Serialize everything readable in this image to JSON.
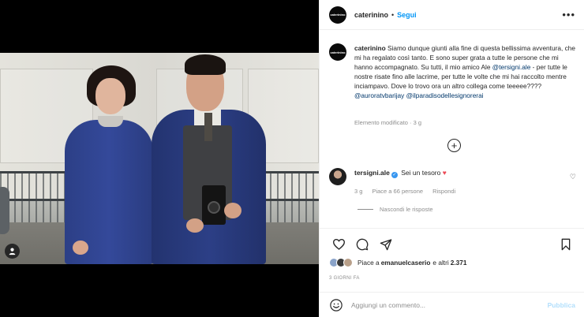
{
  "post": {
    "author": "caterinino",
    "follow_label": "Segui",
    "avatar_text": "caterinino",
    "more_label": "•••"
  },
  "caption": {
    "username": "caterinino",
    "text_1": "Siamo dunque giunti alla fine di questa bellissima avventura, che mi ha regalato così tanto. E sono super grata a tutte le persone che mi hanno accompagnato. Su tutti, il mio amico Ale ",
    "mention_1": "@tersigni.ale",
    "text_2": " - per tutte le nostre risate fino alle lacrime, per tutte le volte che mi hai raccolto mentre inciampavo. Dove lo trovo ora un altro collega come teeeee???? ",
    "mention_2": "@auroratvbarijay",
    "mention_3": "@ilparadisodellesignorerai",
    "meta": "Elemento modificato · 3 g"
  },
  "comments": [
    {
      "username": "tersigni.ale",
      "text": "Sei un tesoro",
      "emoji": "♥",
      "time": "3 g",
      "likes": "Piace a 66 persone",
      "reply_label": "Rispondi"
    }
  ],
  "replies_toggle": "Nascondi le risposte",
  "likes": {
    "prefix": "Piace a ",
    "user": "emanuelcaserio",
    "suffix": " e altri ",
    "count": "2.371"
  },
  "time_ago": "3 GIORNI FA",
  "add_comment": {
    "placeholder": "Aggiungi un commento...",
    "publish_label": "Pubblica"
  },
  "colors": {
    "link": "#0095f6",
    "mention": "#00376b",
    "muted": "#8e8e8e",
    "heart": "#ed4956"
  }
}
